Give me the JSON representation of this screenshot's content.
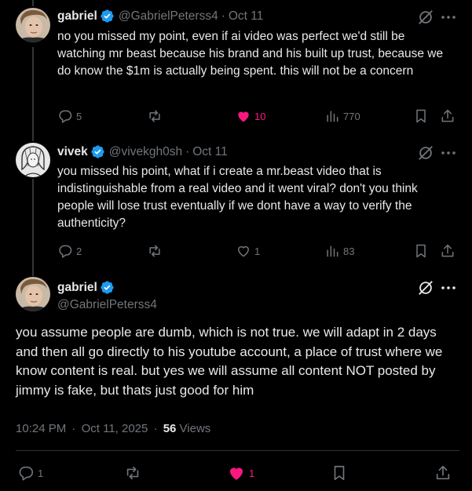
{
  "tweet1": {
    "name": "gabriel",
    "handle": "@GabrielPeterss4",
    "sep": "·",
    "date": "Oct 11",
    "text": "no you missed my point, even if ai video was perfect we'd still be watching mr beast because his brand and his built up trust, because we do know the $1m is actually being spent. this will not be a concern",
    "replies": "5",
    "reposts": "",
    "likes": "10",
    "views": "770"
  },
  "tweet2": {
    "name": "vivek",
    "handle": "@vivekgh0sh",
    "sep": "·",
    "date": "Oct 11",
    "text": "you missed his point, what if i create a mr.beast video that is indistinguishable from a real video and it went viral? don't you think people will lose trust eventually if we dont have a way to verify the authenticity?",
    "replies": "2",
    "reposts": "",
    "likes": "1",
    "views": "83"
  },
  "main": {
    "name": "gabriel",
    "handle": "@GabrielPeterss4",
    "text": "you assume people are dumb, which is not true. we will adapt in 2 days and then all go directly to his youtube account, a place of trust where we know content is real. but yes we will assume all content NOT posted by jimmy is fake, but thats just good for him",
    "time": "10:24 PM",
    "sep1": "·",
    "date": "Oct 11, 2025",
    "sep2": "·",
    "views_count": "56",
    "views_label": "Views",
    "replies": "1",
    "reposts": "",
    "likes": "1"
  },
  "colors": {
    "background": "#000000",
    "text": "#e7e9ea",
    "muted": "#71767b",
    "verified": "#1d9bf0",
    "like": "#f91880"
  }
}
